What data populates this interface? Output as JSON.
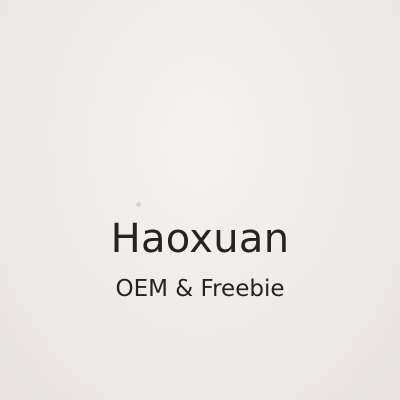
{
  "brand": {
    "name": "Haoxuan",
    "tagline": "OEM & Freebie"
  },
  "colors": {
    "background": "#efebe8",
    "text": "#232323"
  }
}
